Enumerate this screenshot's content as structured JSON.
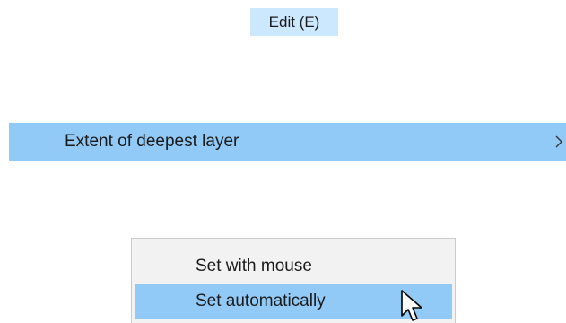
{
  "menubar": {
    "edit_label": "Edit (E)"
  },
  "menu": {
    "highlighted_item": {
      "label": "Extent of deepest layer",
      "submenu_icon": "chevron-right-icon"
    }
  },
  "submenu": {
    "items": [
      {
        "label": "Set with mouse",
        "highlighted": false
      },
      {
        "label": "Set automatically",
        "highlighted": true
      }
    ]
  },
  "colors": {
    "menubar_highlight": "#cce8ff",
    "row_highlight": "#91c9f7",
    "submenu_bg": "#f2f2f2",
    "submenu_border": "#cccccc"
  }
}
